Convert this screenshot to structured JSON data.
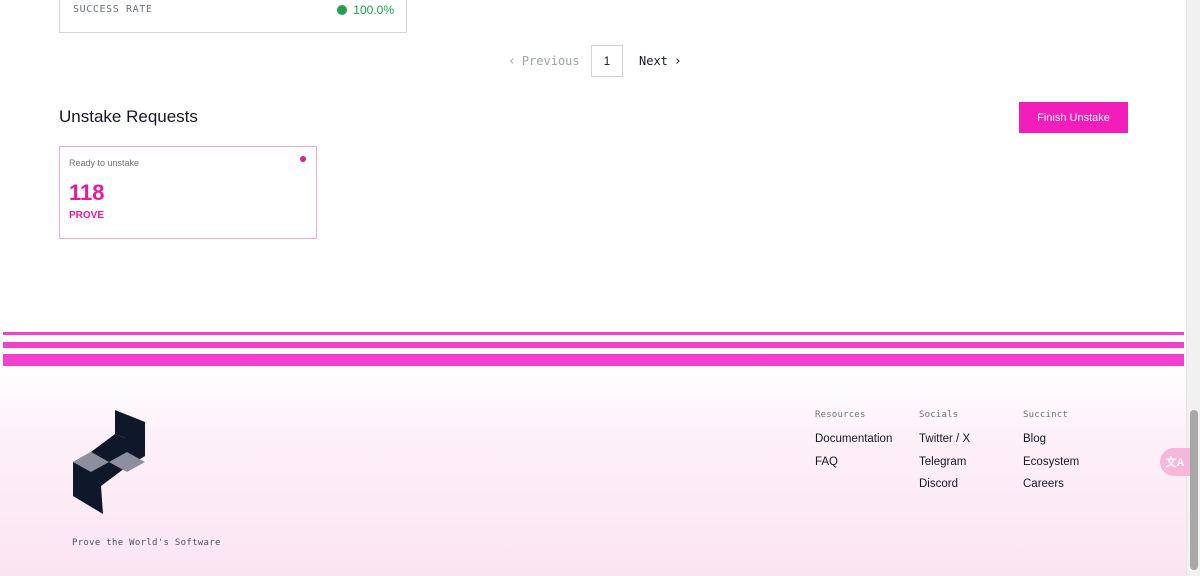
{
  "stats": {
    "success_rate_label": "SUCCESS RATE",
    "success_rate_value": "100.0%",
    "status_color": "#22a04b"
  },
  "pagination": {
    "prev_label": "Previous",
    "current_page": "1",
    "next_label": "Next"
  },
  "unstake": {
    "title": "Unstake Requests",
    "finish_button": "Finish Unstake",
    "card": {
      "status": "Ready to unstake",
      "amount": "118",
      "unit": "PROVE"
    },
    "accent_color": "#f31dbc"
  },
  "footer": {
    "logo_icon": "succinct-logo",
    "tagline": "Prove the World's Software",
    "columns": [
      {
        "heading": "Resources",
        "links": [
          "Documentation",
          "FAQ"
        ]
      },
      {
        "heading": "Socials",
        "links": [
          "Twitter / X",
          "Telegram",
          "Discord"
        ]
      },
      {
        "heading": "Succinct",
        "links": [
          "Blog",
          "Ecosystem",
          "Careers"
        ]
      }
    ]
  },
  "translate": {
    "icon": "translate-icon",
    "glyph": "文A"
  }
}
